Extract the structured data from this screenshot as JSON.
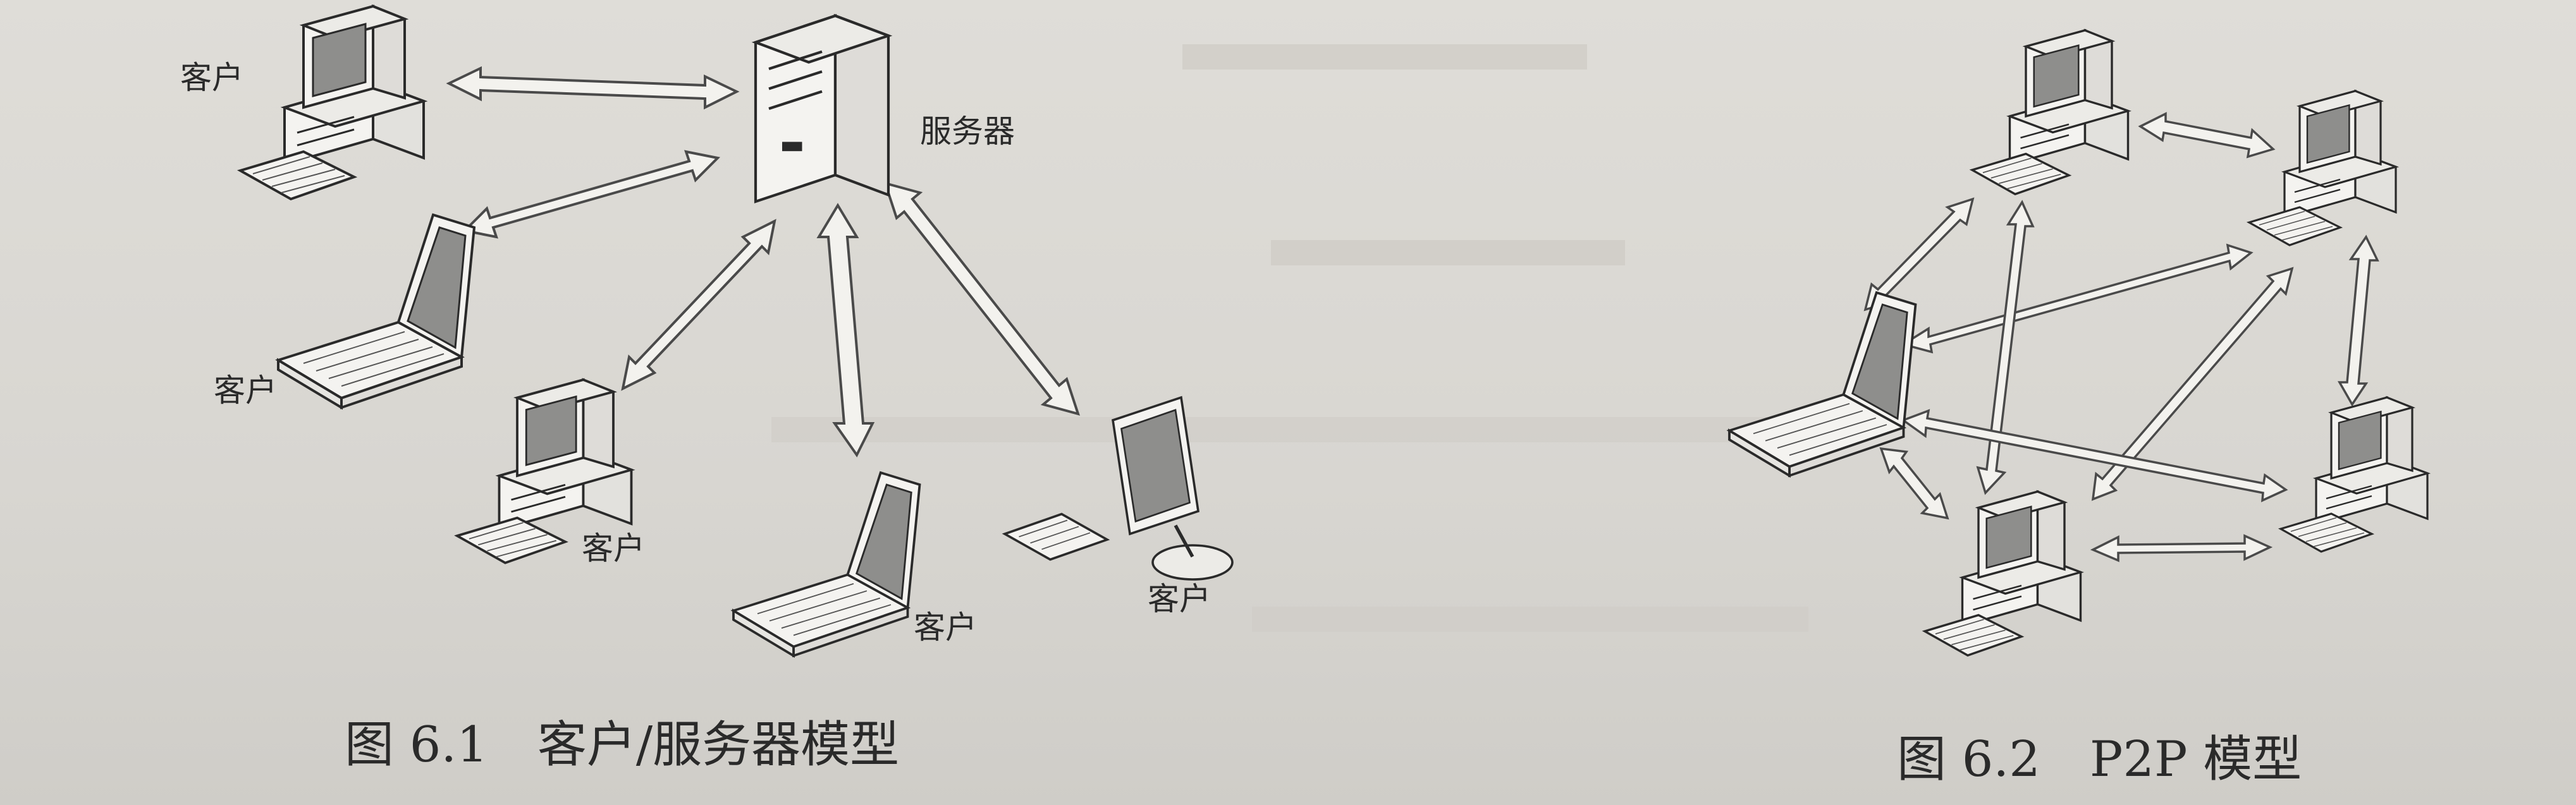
{
  "figure1": {
    "server_label": "服务器",
    "client_label": "客户",
    "caption": "图 6.1　客户/服务器模型"
  },
  "figure2": {
    "caption": "图 6.2　P2P 模型"
  },
  "colors": {
    "ink": "#2a2a2a",
    "device_fill": "#f4f3f0",
    "screen_fill": "#8e8e8c",
    "arrow_stroke": "#4a4a4a",
    "arrow_fill": "#f3f2ee"
  }
}
